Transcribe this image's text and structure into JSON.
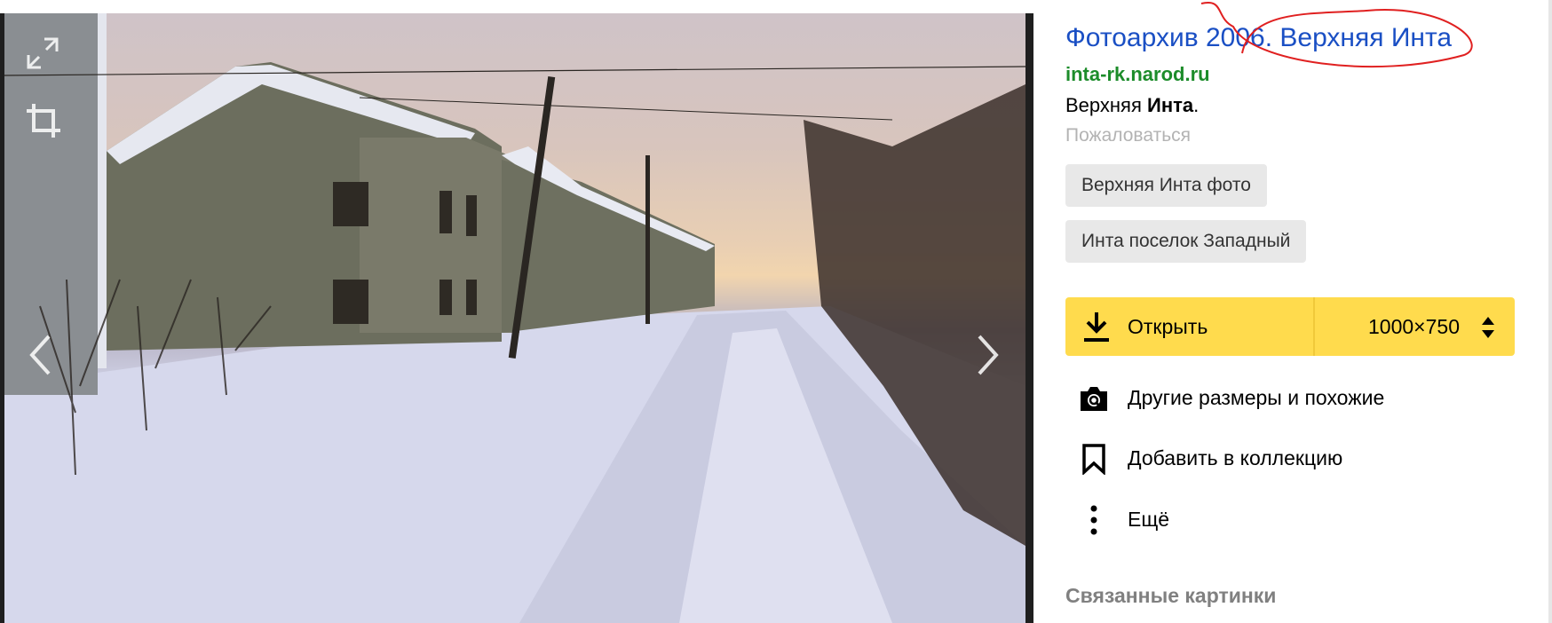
{
  "viewer": {
    "icons": {
      "fullscreen": "expand-icon",
      "crop": "crop-icon",
      "prev": "chevron-left-icon",
      "next": "chevron-right-icon"
    }
  },
  "result": {
    "title": "Фотоархив 2006. Верхняя Инта",
    "host": "inta-rk.narod.ru",
    "description_plain": "Верхняя ",
    "description_bold": "Инта",
    "description_end": ".",
    "report_link": "Пожаловаться"
  },
  "tags": [
    "Верхняя Инта фото",
    "Инта поселок Западный"
  ],
  "open_button": {
    "label": "Открыть",
    "size": "1000×750",
    "icon": "download-icon",
    "size_toggle_icon": "sort-arrows-icon"
  },
  "actions": {
    "other_sizes": "Другие размеры и похожие",
    "add_collection": "Добавить в коллекцию",
    "more": "Ещё"
  },
  "sections": {
    "related": "Связанные картинки"
  },
  "colors": {
    "link": "#1a4fc4",
    "host": "#1c8c2a",
    "accent": "#ffdb4d",
    "annotation": "#e02020"
  }
}
